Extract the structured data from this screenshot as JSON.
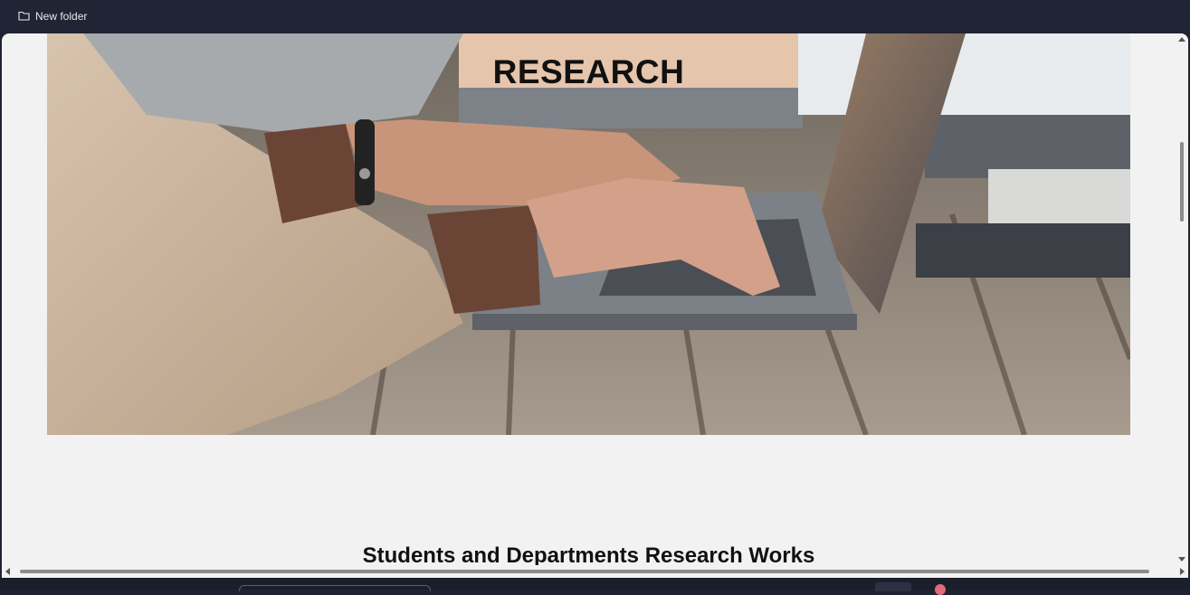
{
  "bookmarks": [
    {
      "label": "New folder",
      "icon": "folder-icon"
    }
  ],
  "hero": {
    "title": "RESEARCH",
    "image": "hands-typing-on-laptop-photo"
  },
  "section": {
    "title": "Students and Departments Research Works"
  },
  "colors": {
    "chrome": "#202434",
    "page_background": "#f2f2f2",
    "text": "#111111"
  }
}
